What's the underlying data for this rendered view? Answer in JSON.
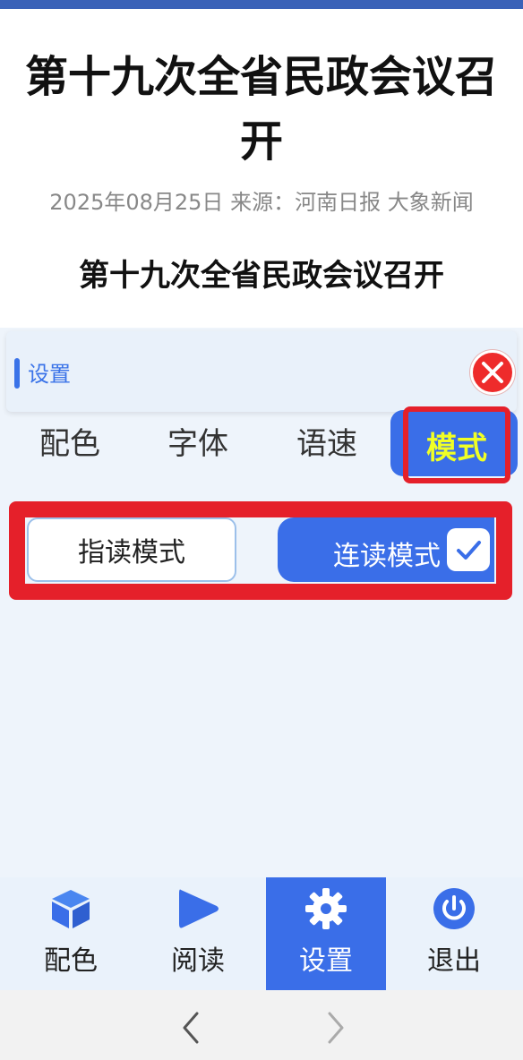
{
  "article": {
    "title": "第十九次全省民政会议召开",
    "meta": "2025年08月25日 来源：河南日报 大象新闻",
    "subtitle": "第十九次全省民政会议召开"
  },
  "settings": {
    "header_label": "设置",
    "tabs": [
      {
        "label": "配色"
      },
      {
        "label": "字体"
      },
      {
        "label": "语速"
      },
      {
        "label": "模式",
        "selected": true
      }
    ],
    "modes": {
      "finger_label": "指读模式",
      "continuous_label": "连读模式",
      "selected": "连读模式"
    }
  },
  "bottom_nav": {
    "items": [
      {
        "label": "配色",
        "icon": "cube-icon"
      },
      {
        "label": "阅读",
        "icon": "play-icon"
      },
      {
        "label": "设置",
        "icon": "gear-icon",
        "active": true
      },
      {
        "label": "退出",
        "icon": "power-icon"
      }
    ]
  },
  "colors": {
    "accent": "#3a6ee8",
    "highlight_border": "#e5202a",
    "close_red": "#ee2b2b",
    "selected_tab_text": "#f0ff25",
    "panel_background": "#eef4fb"
  }
}
